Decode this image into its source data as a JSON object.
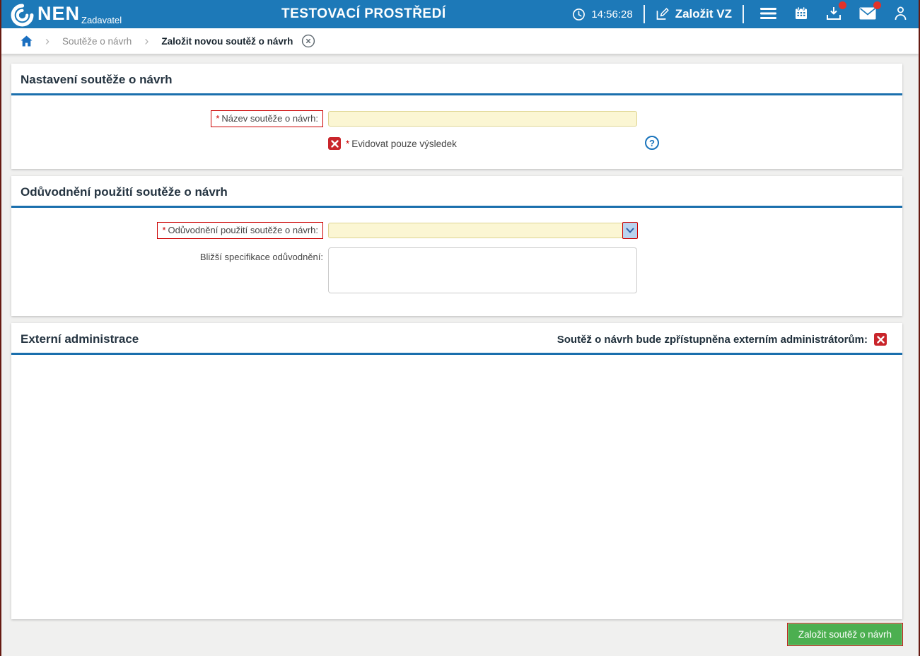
{
  "header": {
    "brand": "NEN",
    "brand_role": "Zadavatel",
    "environment": "TESTOVACÍ PROSTŘEDÍ",
    "clock_time": "14:56:28",
    "create_vz_label": "Založit VZ",
    "icons": [
      "clock-icon",
      "edit-icon",
      "menu-icon",
      "calendar-icon",
      "download-icon",
      "mail-icon",
      "user-icon"
    ],
    "notifications": {
      "download_badge": "dot",
      "mail_badge": "dot"
    }
  },
  "breadcrumb": {
    "home_icon": "home-icon",
    "items": [
      {
        "label": "Soutěže o návrh",
        "current": false
      },
      {
        "label": "Založit novou soutěž o návrh",
        "current": true
      }
    ],
    "close_icon": "close-circle-icon"
  },
  "sections": {
    "settings": {
      "title": "Nastavení soutěže o návrh",
      "name_field": {
        "required_mark": "*",
        "label": "Název soutěže o návrh:",
        "value": ""
      },
      "record_only_toggle": {
        "required_mark": "*",
        "label": "Evidovat pouze výsledek",
        "state": "no"
      },
      "help_glyph": "?"
    },
    "justification": {
      "title": "Odůvodnění použití soutěže o návrh",
      "reason_field": {
        "required_mark": "*",
        "label": "Odůvodnění použití soutěže o návrh:",
        "value": ""
      },
      "spec_field": {
        "label": "Bližší specifikace odůvodnění:",
        "value": ""
      }
    },
    "external_admin": {
      "title": "Externí administrace",
      "access_toggle": {
        "label": "Soutěž o návrh bude zpřístupněna externím administrátorům:",
        "state": "no"
      }
    }
  },
  "footer": {
    "submit_label": "Založit soutěž o návrh"
  },
  "colors": {
    "header_blue": "#1d79b8",
    "section_rule_blue": "#1a6fad",
    "required_red": "#cc0000",
    "toggle_red": "#c9252b",
    "field_yellow_bg": "#fbf6d3",
    "field_yellow_border": "#ded592",
    "button_green": "#4caf50",
    "page_bg": "#f0f0ef",
    "window_edge": "#661a12"
  }
}
